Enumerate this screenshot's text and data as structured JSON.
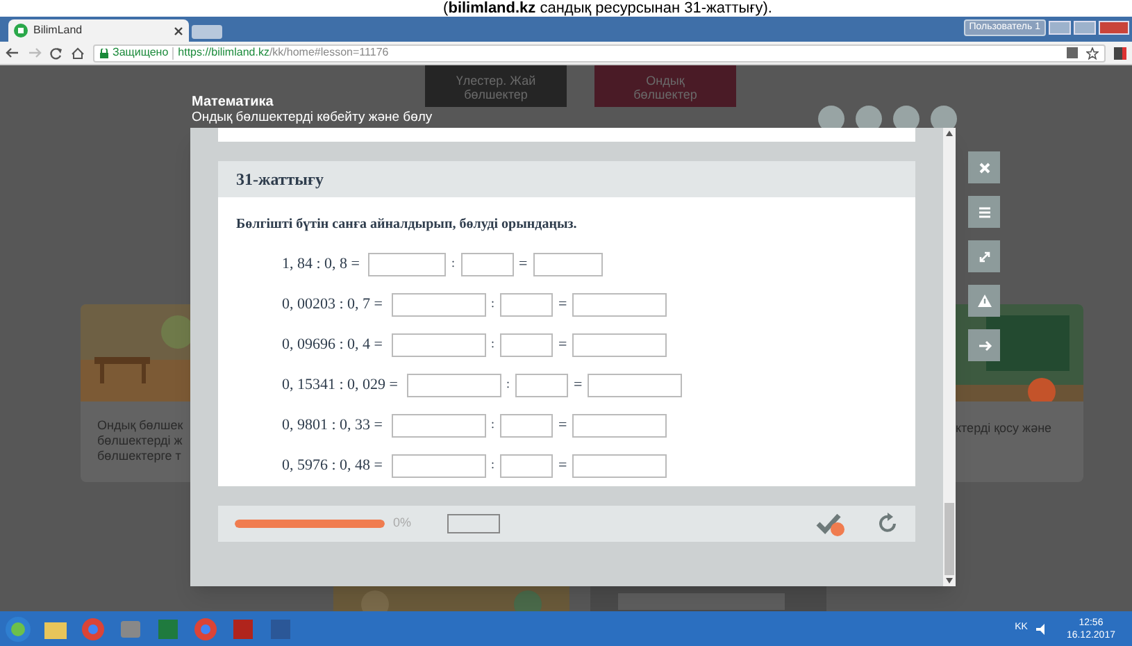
{
  "caption": {
    "text": "(**bilimland.kz** сандық ресурсынан 31-жаттығу)."
  },
  "browser": {
    "tab_title": "BilimLand",
    "secure_label": "Защищено",
    "url_host": "https://bilimland.kz",
    "url_path": "/kk/home#lesson=11176",
    "user_label": "Пользователь 1"
  },
  "page": {
    "subject": "Математика",
    "lesson": "Ондық бөлшектерді көбейту және бөлу",
    "topic_tabs": [
      {
        "lines": [
          "Үлестер. Жай",
          "бөлшектер"
        ]
      },
      {
        "lines": [
          "Ондық",
          "бөлшектер"
        ]
      }
    ],
    "left_card": {
      "lines": [
        "Ондық бөлшек",
        "бөлшектерді ж",
        "бөлшектерге т"
      ]
    },
    "right_card": {
      "lines": [
        "ктерді қосу және"
      ]
    }
  },
  "exercise": {
    "title": "31-жаттығу",
    "instruction": "Бөлгішті бүтін санға айналдырып, бөлуді орындаңыз.",
    "rows": [
      {
        "expression": "1, 84 : 0, 8 =",
        "colon": ":",
        "equals": "="
      },
      {
        "expression": "0, 00203 : 0, 7 =",
        "colon": ":",
        "equals": "="
      },
      {
        "expression": "0, 09696 : 0, 4 =",
        "colon": ":",
        "equals": "="
      },
      {
        "expression": "0, 15341 : 0, 029 =",
        "colon": ":",
        "equals": "="
      },
      {
        "expression": "0, 9801 : 0, 33 =",
        "colon": ":",
        "equals": "="
      },
      {
        "expression": "0, 5976 : 0, 48 =",
        "colon": ":",
        "equals": "="
      }
    ]
  },
  "progress": {
    "level": 1,
    "reading": "0%"
  },
  "taskbar": {
    "language": "KK",
    "time": "12:56",
    "date": "16.12.2017"
  }
}
